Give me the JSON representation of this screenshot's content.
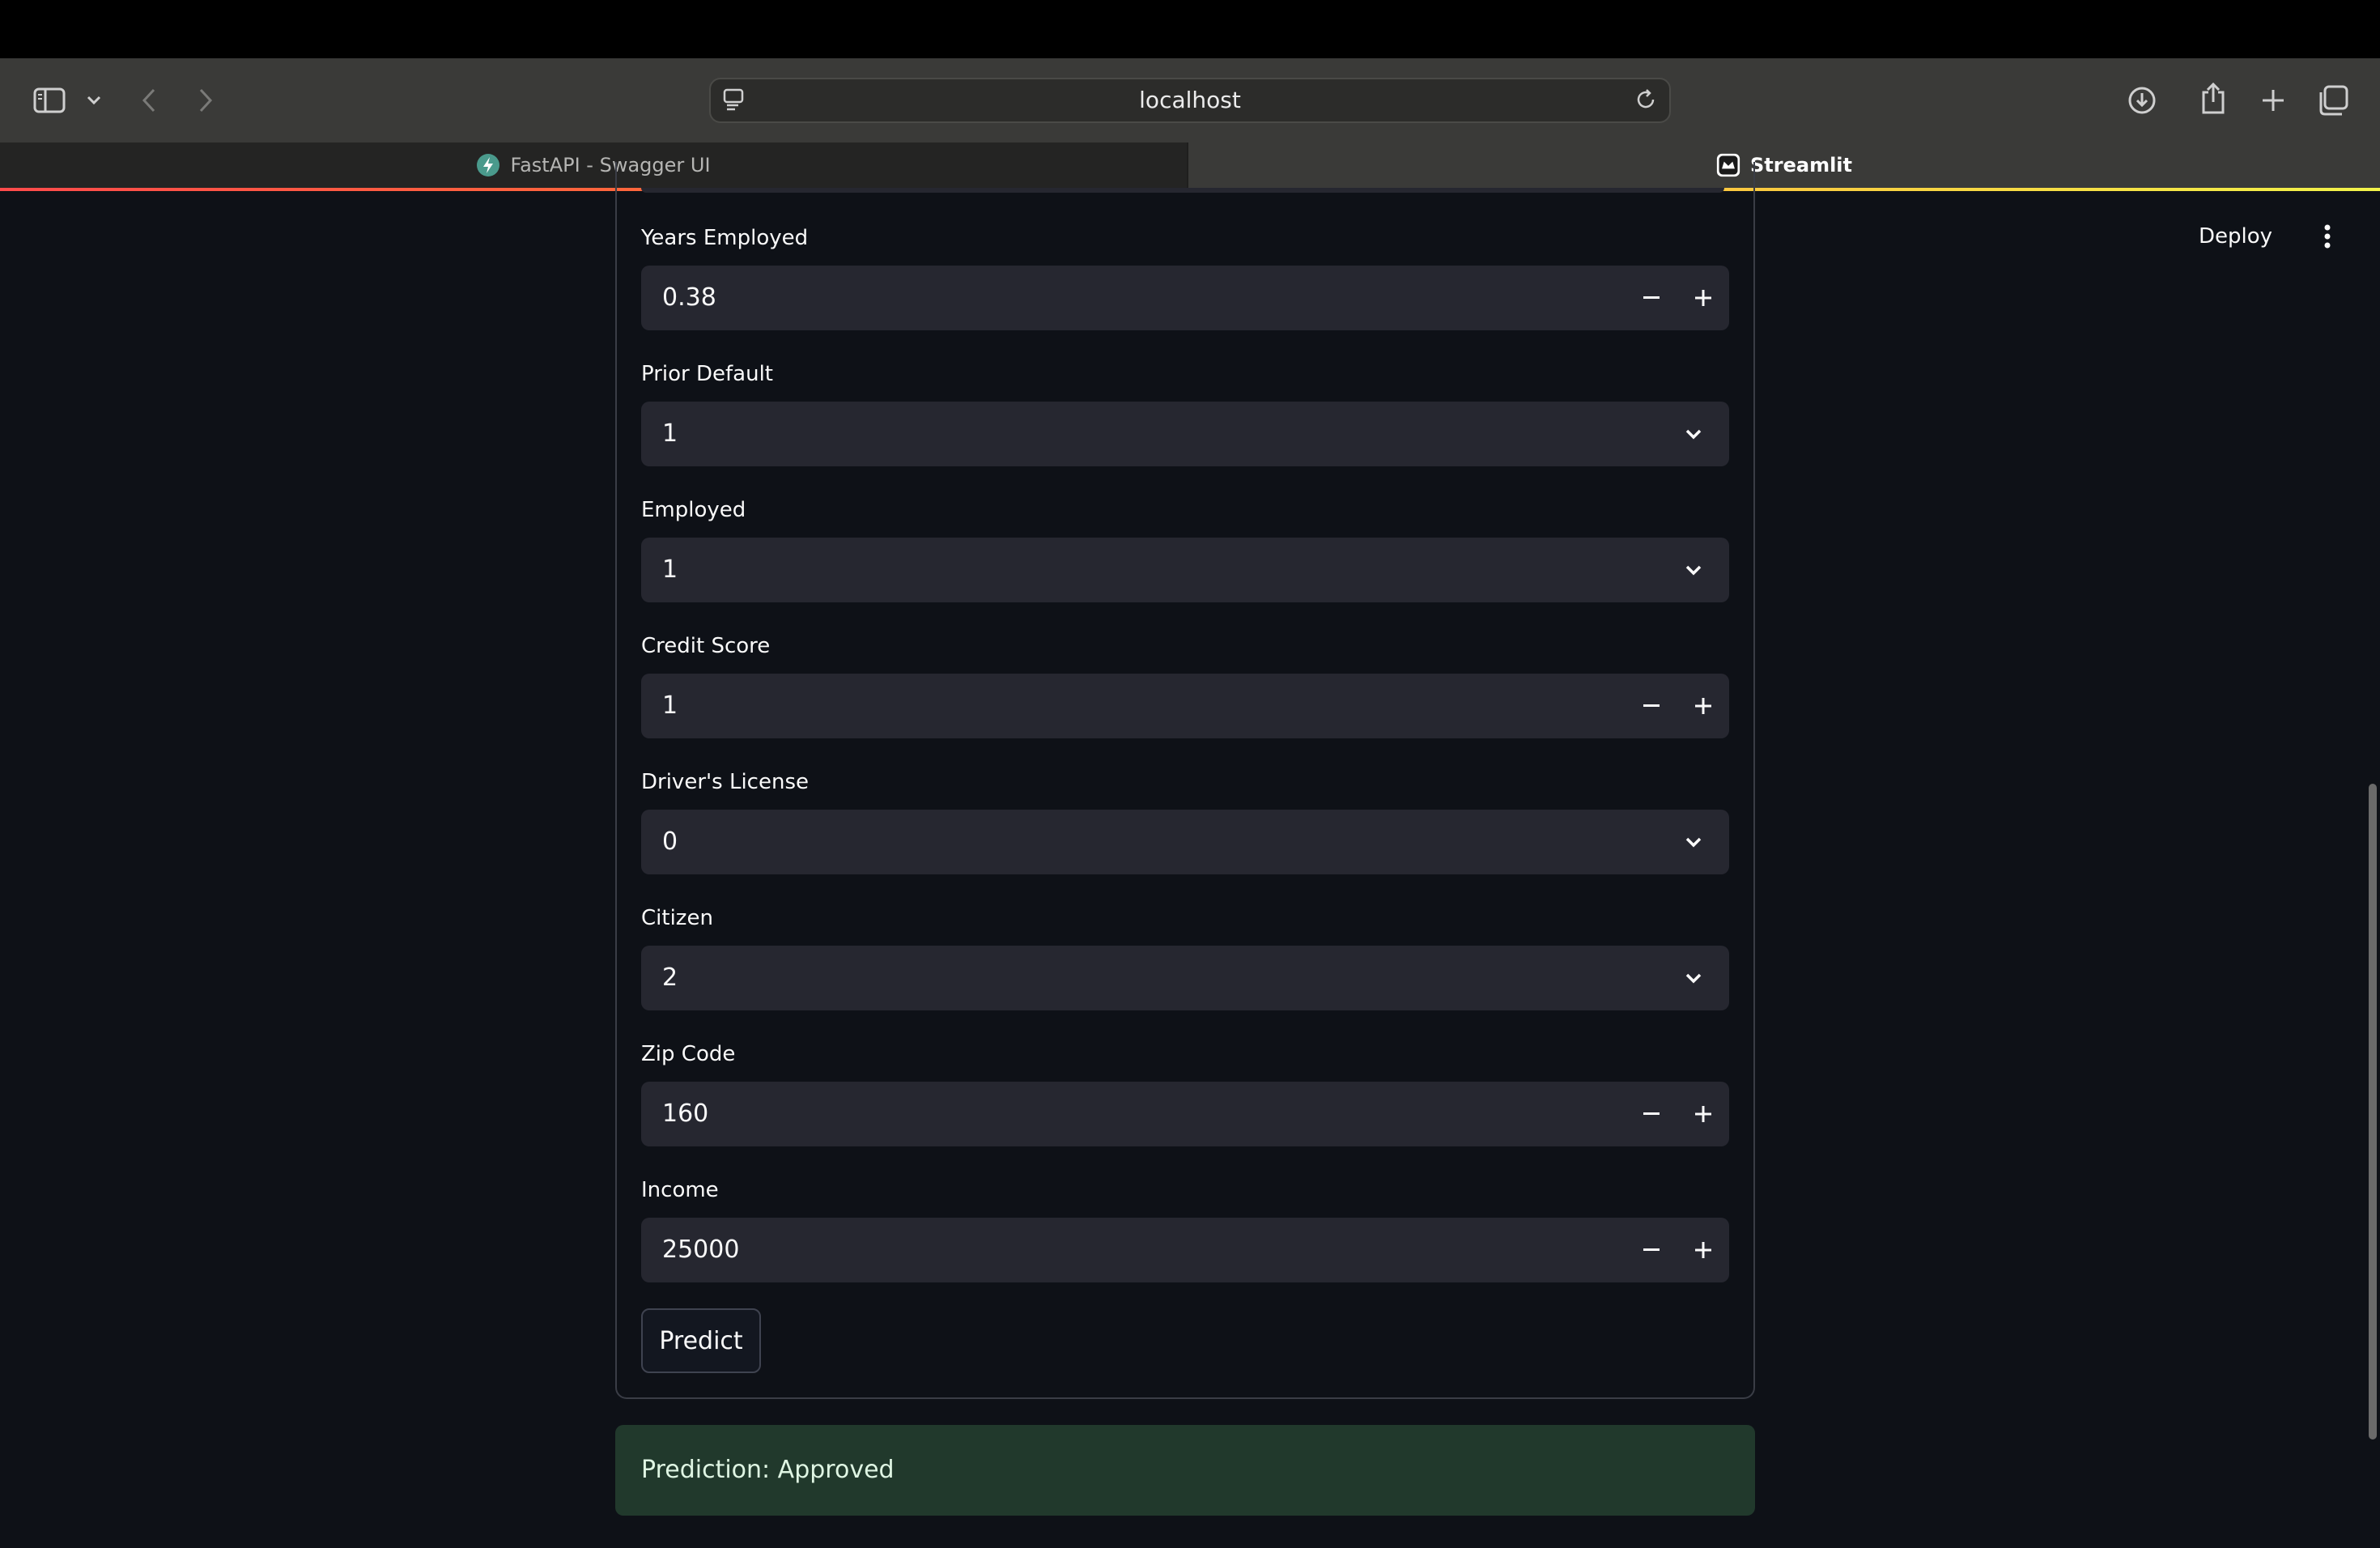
{
  "browser": {
    "address": "localhost",
    "tabs": [
      {
        "label": "FastAPI - Swagger UI",
        "active": false
      },
      {
        "label": "Streamlit",
        "active": true
      }
    ]
  },
  "app": {
    "deploy_label": "Deploy",
    "fields": [
      {
        "label": "Years Employed",
        "value": "0.38",
        "kind": "number"
      },
      {
        "label": "Prior Default",
        "value": "1",
        "kind": "select"
      },
      {
        "label": "Employed",
        "value": "1",
        "kind": "select"
      },
      {
        "label": "Credit Score",
        "value": "1",
        "kind": "number"
      },
      {
        "label": "Driver's License",
        "value": "0",
        "kind": "select"
      },
      {
        "label": "Citizen",
        "value": "2",
        "kind": "select"
      },
      {
        "label": "Zip Code",
        "value": "160",
        "kind": "number"
      },
      {
        "label": "Income",
        "value": "25000",
        "kind": "number"
      }
    ],
    "predict_label": "Predict",
    "result": "Prediction: Approved"
  },
  "colors": {
    "background": "#0e1117",
    "input_bg": "#262730",
    "success_bg": "#21392c"
  }
}
